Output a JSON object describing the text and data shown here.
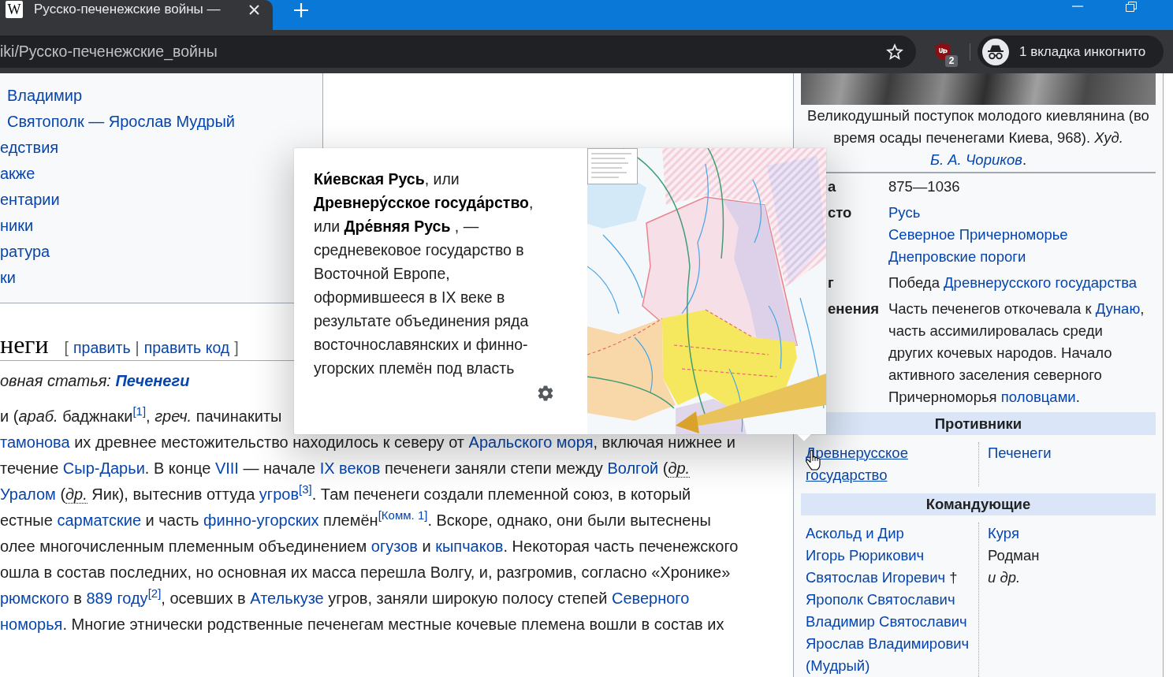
{
  "browser": {
    "tab": {
      "favicon": "W",
      "title": "Русско-печенежские войны —"
    },
    "address": "iki/Русско-печенежские_войны",
    "extension_badge": "2",
    "incognito_label": "1 вкладка инкогнито"
  },
  "toc": {
    "items": [
      {
        "children": [
          {
            "label": "Владимир"
          },
          {
            "label": "Святополк — Ярослав Мудрый"
          }
        ]
      },
      {
        "label": "едствия"
      },
      {
        "label": "акже"
      },
      {
        "label": "ентарии"
      },
      {
        "label": "ники"
      },
      {
        "label": "ратура"
      },
      {
        "label": "ки"
      }
    ]
  },
  "section": {
    "heading": "неги",
    "edit": {
      "open": "[",
      "links": [
        "править",
        "править код"
      ],
      "separator": "|",
      "close": "]"
    },
    "hatnote": {
      "text": "овная статья:",
      "link": "Печенеги"
    },
    "paragraph_lines": [
      [
        {
          "kind": "text",
          "text": "и ("
        },
        {
          "kind": "italic",
          "text": "араб."
        },
        {
          "kind": "text",
          "text": " баджнаки"
        },
        {
          "kind": "ref",
          "text": "[1]"
        },
        {
          "kind": "text",
          "text": ", "
        },
        {
          "kind": "italic",
          "text": "греч."
        },
        {
          "kind": "text",
          "text": " пачинакиты"
        }
      ],
      [
        {
          "kind": "link",
          "text": "тамонова"
        },
        {
          "kind": "text",
          "text": " их древнее местожительство находилось к северу от "
        },
        {
          "kind": "link",
          "text": "Аральского моря"
        },
        {
          "kind": "text",
          "text": ", включая нижнее и"
        }
      ],
      [
        {
          "kind": "text",
          "text": "течение "
        },
        {
          "kind": "link",
          "text": "Сыр-Дарьи"
        },
        {
          "kind": "text",
          "text": ". В конце "
        },
        {
          "kind": "link",
          "text": "VIII"
        },
        {
          "kind": "text",
          "text": " — начале "
        },
        {
          "kind": "link",
          "text": "IX веков"
        },
        {
          "kind": "text",
          "text": " печенеги заняли степи между "
        },
        {
          "kind": "link",
          "text": "Волгой"
        },
        {
          "kind": "text",
          "text": " ("
        },
        {
          "kind": "abbr",
          "text": "др."
        }
      ],
      [
        {
          "kind": "link",
          "text": "Уралом"
        },
        {
          "kind": "text",
          "text": " ("
        },
        {
          "kind": "abbr",
          "text": "др."
        },
        {
          "kind": "text",
          "text": " Яик), вытеснив оттуда "
        },
        {
          "kind": "link",
          "text": "угров"
        },
        {
          "kind": "ref",
          "text": "[3]"
        },
        {
          "kind": "text",
          "text": ". Там печенеги создали племенной союз, в который"
        }
      ],
      [
        {
          "kind": "text",
          "text": "естные "
        },
        {
          "kind": "link",
          "text": "сарматские"
        },
        {
          "kind": "text",
          "text": " и часть "
        },
        {
          "kind": "link",
          "text": "финно-угорских"
        },
        {
          "kind": "text",
          "text": " племён"
        },
        {
          "kind": "ref",
          "text": "[Комм. 1]"
        },
        {
          "kind": "text",
          "text": ". Вскоре, однако, они были вытеснены"
        }
      ],
      [
        {
          "kind": "text",
          "text": "олее многочисленным племенным объединением "
        },
        {
          "kind": "link",
          "text": "огузов"
        },
        {
          "kind": "text",
          "text": " и "
        },
        {
          "kind": "link",
          "text": "кыпчаков"
        },
        {
          "kind": "text",
          "text": ". Некоторая часть печенежского"
        }
      ],
      [
        {
          "kind": "text",
          "text": "ошла в состав последних, но основная их масса перешла Волгу, и, разгромив, согласно «Хронике»"
        }
      ],
      [
        {
          "kind": "link",
          "text": "рюмского"
        },
        {
          "kind": "text",
          "text": " в "
        },
        {
          "kind": "link",
          "text": "889 году"
        },
        {
          "kind": "ref",
          "text": "[2]"
        },
        {
          "kind": "text",
          "text": ", осевших в "
        },
        {
          "kind": "link",
          "text": "Ателькузе"
        },
        {
          "kind": "text",
          "text": " угров, заняли широкую полосу степей "
        },
        {
          "kind": "link",
          "text": "Северного"
        }
      ],
      [
        {
          "kind": "link",
          "text": "номорья"
        },
        {
          "kind": "text",
          "text": ". Многие этнически родственные печенегам местные кочевые племена вошли в состав их"
        }
      ]
    ]
  },
  "popup": {
    "text": "**Ки́евская Русь**, или **Древнеру́сское госуда́рство**, или **Дре́вняя Русь** , — средневековое государство в Восточной Европе, оформившееся в IX веке в результате объединения ряда восточнославянских и финно-угорских племён под власть"
  },
  "infobox": {
    "caption": [
      {
        "kind": "text",
        "text": "Великодушный поступок молодого киевлянина (во время осады печенегами Киева, 968). "
      },
      {
        "kind": "italic",
        "text": "Худ. "
      },
      {
        "kind": "italic_link",
        "text": "Б. А. Чориков"
      },
      {
        "kind": "text",
        "text": "."
      }
    ],
    "rows": [
      {
        "label": "а",
        "value": [
          [
            {
              "kind": "text",
              "text": "875—1036"
            }
          ]
        ]
      },
      {
        "label": "сто",
        "value": [
          [
            {
              "kind": "link",
              "text": "Русь"
            }
          ],
          [
            {
              "kind": "link",
              "text": "Северное Причерноморье"
            }
          ],
          [
            {
              "kind": "link",
              "text": "Днепровские пороги"
            }
          ]
        ]
      },
      {
        "label": "г",
        "value": [
          [
            {
              "kind": "text",
              "text": "Победа "
            },
            {
              "kind": "link",
              "text": "Древнерусского государства"
            }
          ]
        ]
      },
      {
        "label": "енения",
        "value": [
          [
            {
              "kind": "text",
              "text": "Часть печенегов откочевала к "
            },
            {
              "kind": "link",
              "text": "Дунаю"
            },
            {
              "kind": "text",
              "text": ", часть ассимилировалась среди других кочевых народов. Начало активного заселения северного Причерноморья "
            },
            {
              "kind": "link",
              "text": "половцами"
            },
            {
              "kind": "text",
              "text": "."
            }
          ]
        ]
      }
    ],
    "sections": [
      {
        "title": "Противники",
        "left": [
          {
            "kind": "link",
            "text": "Древнерусское государство",
            "hovered": true
          }
        ],
        "right": [
          {
            "kind": "link",
            "text": "Печенеги",
            "hovered": false
          }
        ]
      },
      {
        "title": "Командующие",
        "left": [
          {
            "kind": "link",
            "text": "Аскольд и Дир",
            "hovered": false
          },
          {
            "kind": "link",
            "text": "Игорь Рюрикович",
            "hovered": false
          },
          {
            "kind": "link",
            "text": "Святослав Игоревич",
            "hovered": false,
            "suffix": "†"
          },
          {
            "kind": "link",
            "text": "Ярополк Святославич",
            "hovered": false
          },
          {
            "kind": "link",
            "text": "Владимир Святославич",
            "hovered": false
          },
          {
            "kind": "link",
            "text": "Ярослав Владимирович (Мудрый)",
            "hovered": false
          }
        ],
        "right": [
          {
            "kind": "link",
            "text": "Куря",
            "hovered": false
          },
          {
            "kind": "text",
            "text": "Родман",
            "hovered": false
          },
          {
            "kind": "italic",
            "text": "и др.",
            "hovered": false
          }
        ]
      }
    ]
  }
}
